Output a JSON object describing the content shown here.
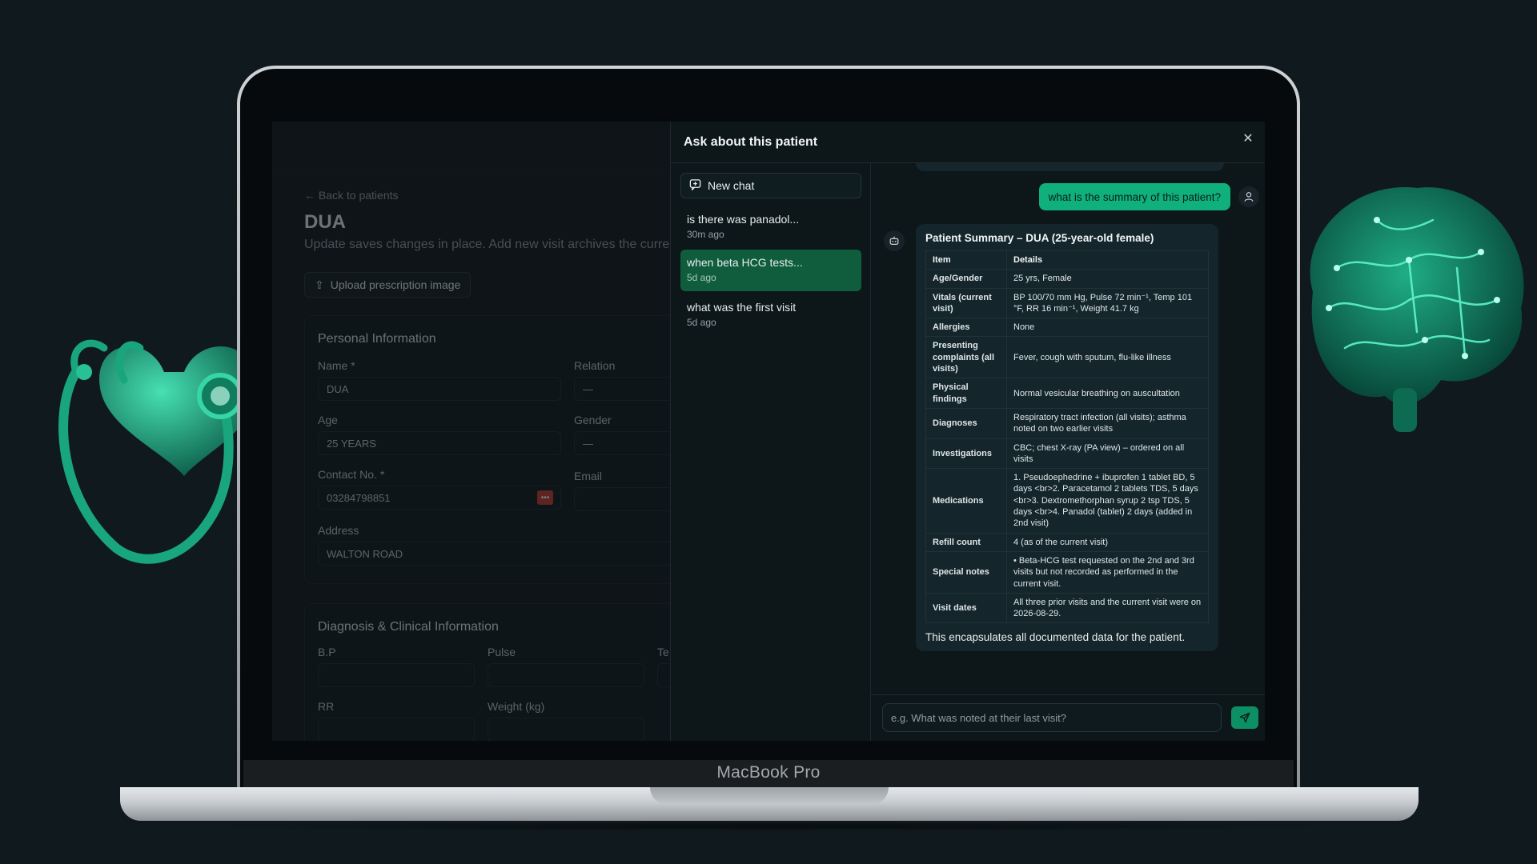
{
  "device_label": "MacBook Pro",
  "form": {
    "back_label": "Back to patients",
    "patient_name": "DUA",
    "subtitle": "Update saves changes in place. Add new visit archives the curre",
    "upload_label": "Upload prescription image",
    "personal": {
      "title": "Personal Information",
      "name_label": "Name *",
      "name_value": "DUA",
      "relation_label": "Relation",
      "relation_value": "—",
      "age_label": "Age",
      "age_value": "25 YEARS",
      "gender_label": "Gender",
      "gender_value": "—",
      "contact_label": "Contact No. *",
      "contact_value": "03284798851",
      "email_label": "Email",
      "address_label": "Address",
      "address_value": "WALTON ROAD"
    },
    "clinical": {
      "title": "Diagnosis & Clinical Information",
      "bp_label": "B.P",
      "pulse_label": "Pulse",
      "temp_label": "Te",
      "rr_label": "RR",
      "weight_label": "Weight (kg)"
    }
  },
  "chat": {
    "title": "Ask about this patient",
    "new_chat_label": "New chat",
    "conversations": [
      {
        "title": "is there was panadol...",
        "time": "30m ago"
      },
      {
        "title": "when beta HCG tests...",
        "time": "5d ago"
      },
      {
        "title": "what was the first visit",
        "time": "5d ago"
      }
    ],
    "user_message": "what is the summary of this patient?",
    "reply": {
      "title": "Patient Summary – DUA (25-year-old female)",
      "headers": [
        "Item",
        "Details"
      ],
      "rows": [
        {
          "k": "Age/Gender",
          "v": "25 yrs, Female"
        },
        {
          "k": "Vitals (current visit)",
          "v": "BP 100/70 mm Hg, Pulse 72 min⁻¹, Temp 101 °F, RR 16 min⁻¹, Weight 41.7 kg"
        },
        {
          "k": "Allergies",
          "v": "None"
        },
        {
          "k": "Presenting complaints (all visits)",
          "v": "Fever, cough with sputum, flu-like illness"
        },
        {
          "k": "Physical findings",
          "v": "Normal vesicular breathing on auscultation"
        },
        {
          "k": "Diagnoses",
          "v": "Respiratory tract infection (all visits); asthma noted on two earlier visits"
        },
        {
          "k": "Investigations",
          "v": "CBC; chest X-ray (PA view) – ordered on all visits"
        },
        {
          "k": "Medications",
          "v": "1. Pseudoephedrine + ibuprofen 1 tablet BD, 5 days <br>2. Paracetamol 2 tablets TDS, 5 days <br>3. Dextromethorphan syrup 2 tsp TDS, 5 days <br>4. Panadol (tablet) 2 days (added in 2nd visit)"
        },
        {
          "k": "Refill count",
          "v": "4 (as of the current visit)"
        },
        {
          "k": "Special notes",
          "v": "• Beta-HCG test requested on the 2nd and 3rd visits but not recorded as performed in the current visit."
        },
        {
          "k": "Visit dates",
          "v": "All three prior visits and the current visit were on 2026-08-29."
        }
      ],
      "footer": "This encapsulates all documented data for the patient."
    },
    "input_placeholder": "e.g. What was noted at their last visit?"
  }
}
